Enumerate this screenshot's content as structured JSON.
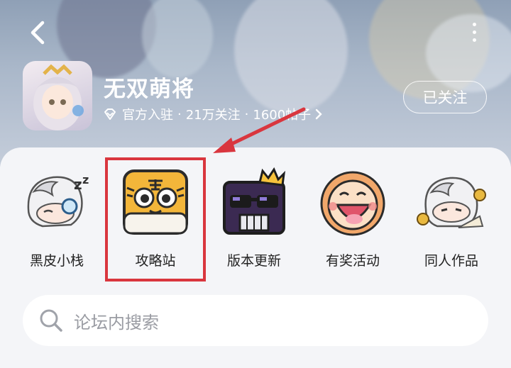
{
  "header": {
    "title": "无双萌将",
    "badge": "官方入驻",
    "followers": "21万关注",
    "posts": "1600帖子",
    "follow_label": "已关注"
  },
  "shortcuts": [
    {
      "label": "黑皮小栈",
      "icon": "sleepy-chibi-icon"
    },
    {
      "label": "攻略站",
      "icon": "tiger-icon"
    },
    {
      "label": "版本更新",
      "icon": "king-sunglasses-icon"
    },
    {
      "label": "有奖活动",
      "icon": "laughing-lion-icon"
    },
    {
      "label": "同人作品",
      "icon": "fan-chibi-icon"
    }
  ],
  "search": {
    "placeholder": "论坛内搜索"
  },
  "annotation": {
    "highlight_color": "#d9363e"
  }
}
